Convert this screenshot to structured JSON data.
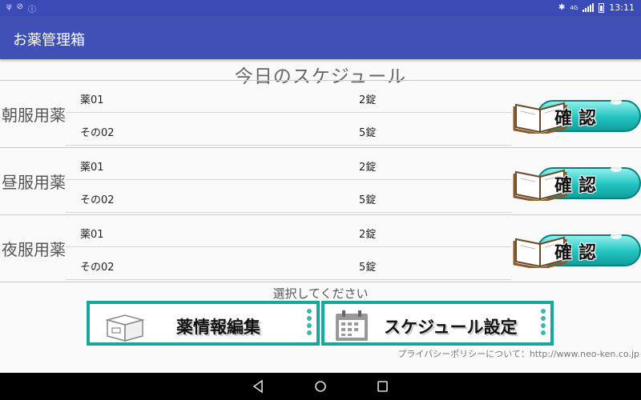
{
  "status_bar": {
    "left_icons": [
      "usb-icon",
      "wifi-off-icon",
      "info-icon"
    ],
    "network_label": "4G",
    "time": "13:11"
  },
  "app_bar": {
    "title": "お薬管理箱"
  },
  "schedule": {
    "title": "今日のスケジュール",
    "periods": [
      {
        "label": "朝服用薬",
        "medicines": [
          {
            "name": "薬01",
            "qty": "2錠"
          },
          {
            "name": "その02",
            "qty": "5錠"
          }
        ],
        "confirm_label": "確認"
      },
      {
        "label": "昼服用薬",
        "medicines": [
          {
            "name": "薬01",
            "qty": "2錠"
          },
          {
            "name": "その02",
            "qty": "5錠"
          }
        ],
        "confirm_label": "確認"
      },
      {
        "label": "夜服用薬",
        "medicines": [
          {
            "name": "薬01",
            "qty": "2錠"
          },
          {
            "name": "その02",
            "qty": "5錠"
          }
        ],
        "confirm_label": "確認"
      }
    ]
  },
  "prompt": "選択してください",
  "actions": {
    "medicine_edit_label": "薬情報編集",
    "schedule_settings_label": "スケジュール設定"
  },
  "footer": {
    "privacy_text": "プライバシーポリシーについて：http://www.neo-ken.co.jp"
  },
  "colors": {
    "status_bar": "#3a4ab7",
    "app_bar": "#3f51b5",
    "accent_teal": "#16a79d",
    "button_teal": "#22c3c0"
  }
}
